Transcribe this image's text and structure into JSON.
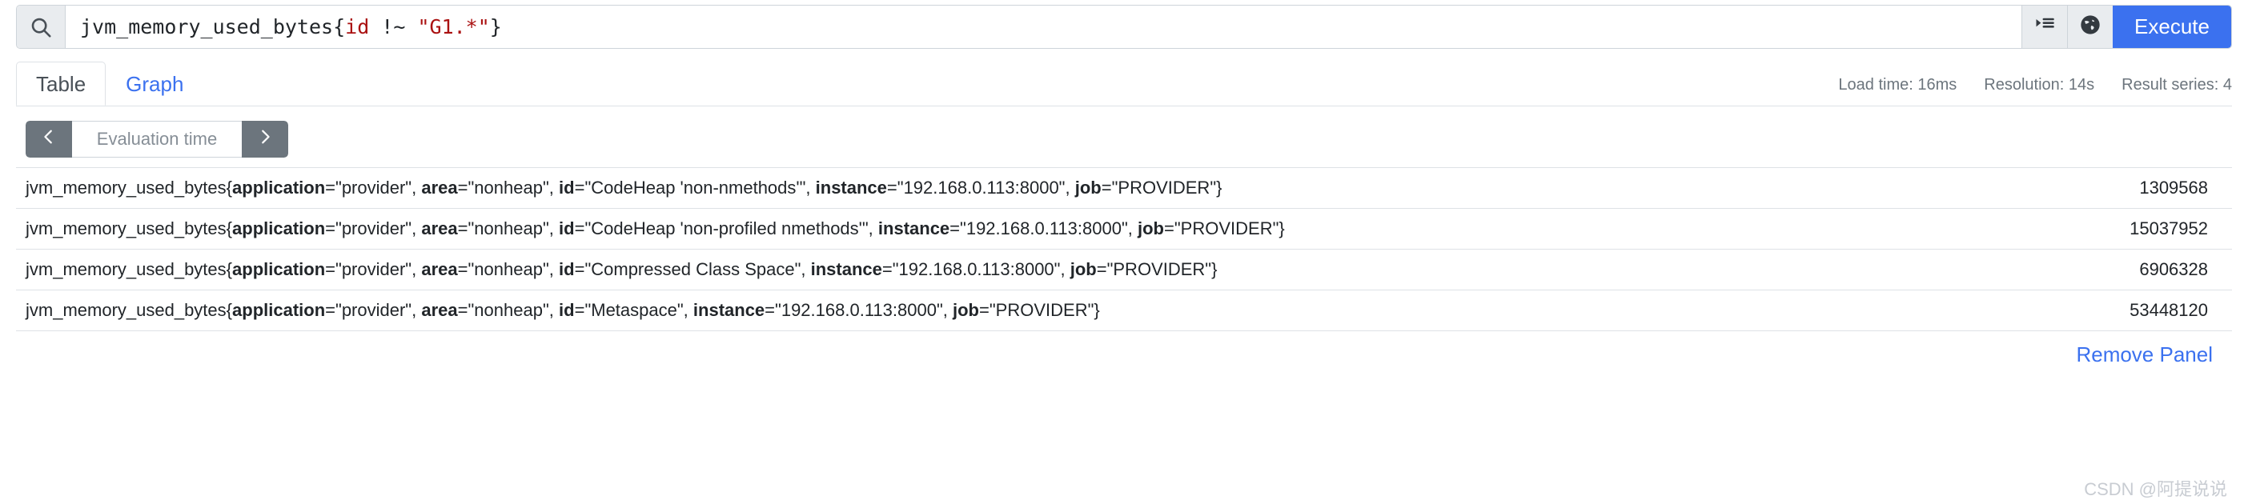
{
  "query_bar": {
    "search_icon": "search-icon",
    "expression": {
      "full_text": "jvm_memory_used_bytes{id !~ \"G1.*\"}",
      "metric": "jvm_memory_used_bytes{",
      "label": "id",
      "operator": " !~ ",
      "value": "\"G1.*\"",
      "close": "}"
    },
    "metrics_explorer_icon": "list-indent-icon",
    "globe_icon": "globe-icon",
    "execute_label": "Execute"
  },
  "tabs": [
    {
      "label": "Table",
      "active": true
    },
    {
      "label": "Graph",
      "active": false
    }
  ],
  "stats": {
    "load_time": "Load time: 16ms",
    "resolution": "Resolution: 14s",
    "result_series": "Result series: 4"
  },
  "evaluation_time": {
    "prev_icon": "chevron-left-icon",
    "next_icon": "chevron-right-icon",
    "placeholder": "Evaluation time",
    "value": ""
  },
  "table": {
    "rows": [
      {
        "metric": "jvm_memory_used_bytes",
        "labels": [
          {
            "key": "application",
            "value": "\"provider\""
          },
          {
            "key": "area",
            "value": "\"nonheap\""
          },
          {
            "key": "id",
            "value": "\"CodeHeap 'non-nmethods'\""
          },
          {
            "key": "instance",
            "value": "\"192.168.0.113:8000\""
          },
          {
            "key": "job",
            "value": "\"PROVIDER\""
          }
        ],
        "value": "1309568"
      },
      {
        "metric": "jvm_memory_used_bytes",
        "labels": [
          {
            "key": "application",
            "value": "\"provider\""
          },
          {
            "key": "area",
            "value": "\"nonheap\""
          },
          {
            "key": "id",
            "value": "\"CodeHeap 'non-profiled nmethods'\""
          },
          {
            "key": "instance",
            "value": "\"192.168.0.113:8000\""
          },
          {
            "key": "job",
            "value": "\"PROVIDER\""
          }
        ],
        "value": "15037952"
      },
      {
        "metric": "jvm_memory_used_bytes",
        "labels": [
          {
            "key": "application",
            "value": "\"provider\""
          },
          {
            "key": "area",
            "value": "\"nonheap\""
          },
          {
            "key": "id",
            "value": "\"Compressed Class Space\""
          },
          {
            "key": "instance",
            "value": "\"192.168.0.113:8000\""
          },
          {
            "key": "job",
            "value": "\"PROVIDER\""
          }
        ],
        "value": "6906328"
      },
      {
        "metric": "jvm_memory_used_bytes",
        "labels": [
          {
            "key": "application",
            "value": "\"provider\""
          },
          {
            "key": "area",
            "value": "\"nonheap\""
          },
          {
            "key": "id",
            "value": "\"Metaspace\""
          },
          {
            "key": "instance",
            "value": "\"192.168.0.113:8000\""
          },
          {
            "key": "job",
            "value": "\"PROVIDER\""
          }
        ],
        "value": "53448120"
      }
    ]
  },
  "footer": {
    "remove_panel_label": "Remove Panel",
    "watermark": "CSDN @阿提说说"
  },
  "colors": {
    "accent": "#3b71ef",
    "muted": "#6c757d",
    "border": "#dee2e6",
    "addon_bg": "#e9ecef",
    "token_red": "#aa1111"
  }
}
